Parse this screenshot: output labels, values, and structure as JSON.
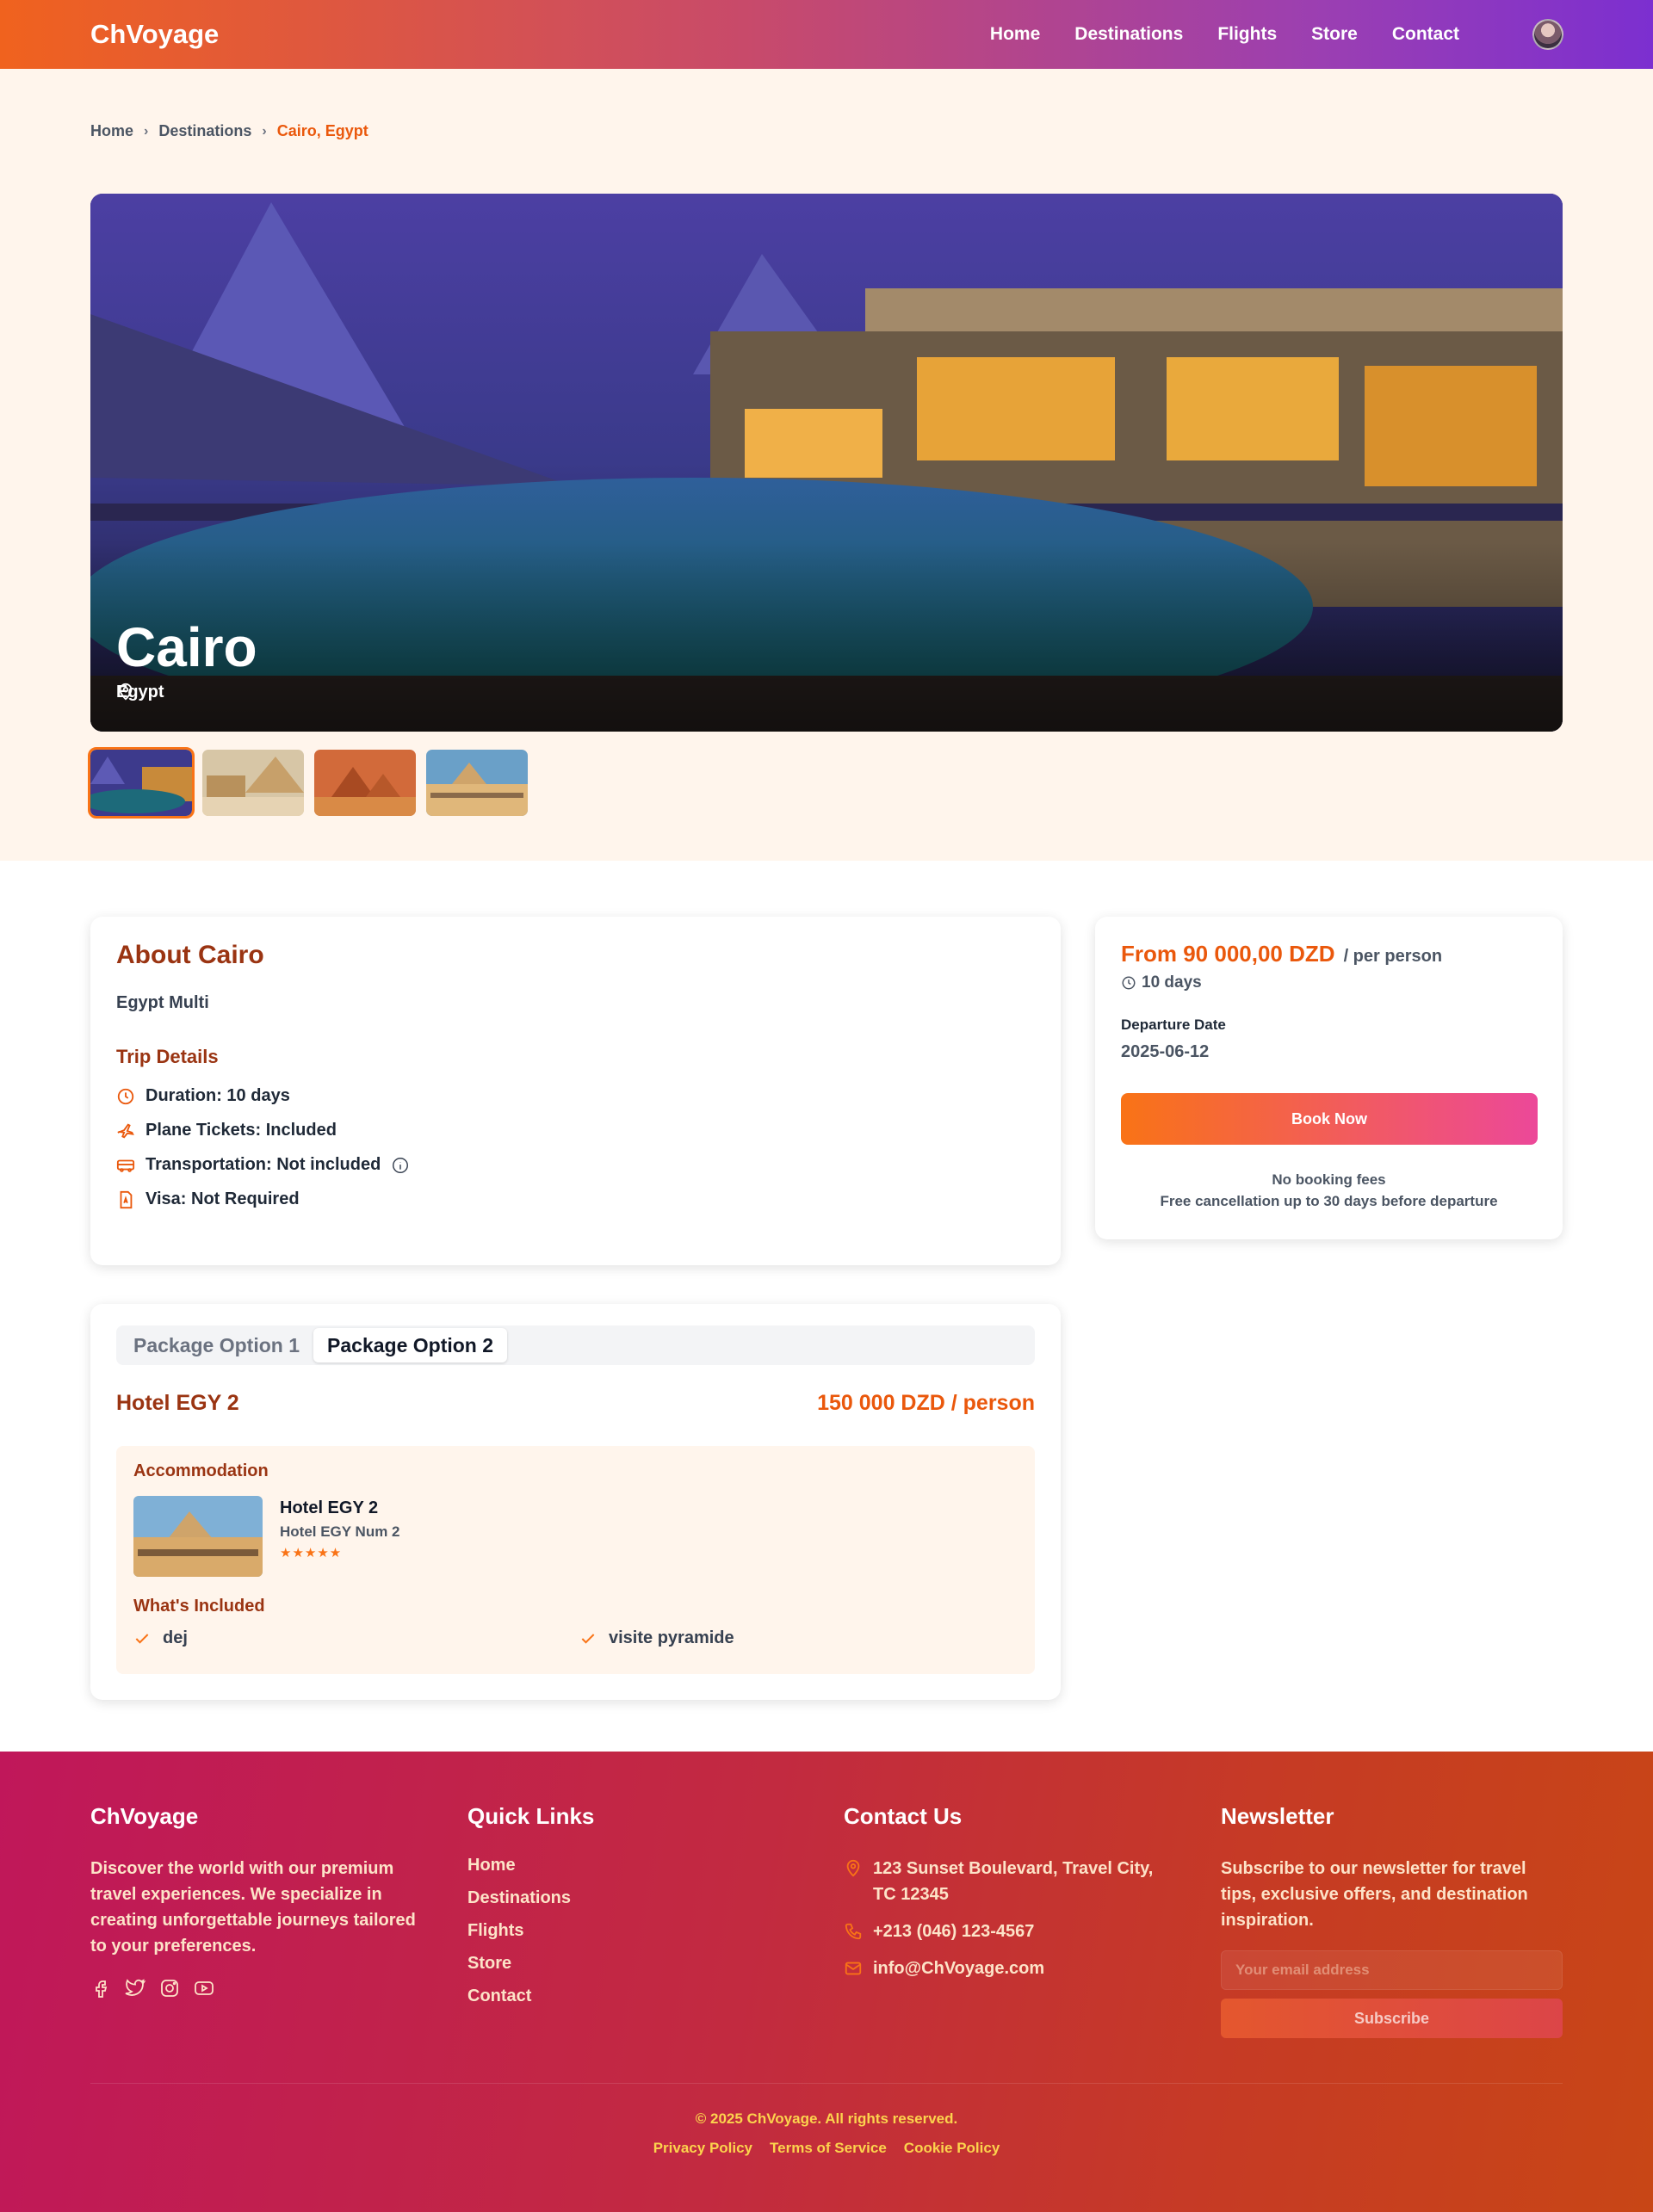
{
  "nav": {
    "brand": "ChVoyage",
    "links": [
      "Home",
      "Destinations",
      "Flights",
      "Store",
      "Contact"
    ]
  },
  "breadcrumb": {
    "items": [
      "Home",
      "Destinations"
    ],
    "current": "Cairo, Egypt"
  },
  "hero": {
    "title": "Cairo",
    "country": "Egypt"
  },
  "about": {
    "title": "About Cairo",
    "subtitle": "Egypt Multi",
    "details_title": "Trip Details",
    "details": [
      "Duration: 10 days",
      "Plane Tickets: Included",
      "Transportation: Not included",
      "Visa: Not Required"
    ]
  },
  "booking": {
    "price": "From 90 000,00 DZD",
    "per": "/ per person",
    "days": "10 days",
    "departure_label": "Departure Date",
    "departure_date": "2025-06-12",
    "button": "Book Now",
    "note1": "No booking fees",
    "note2": "Free cancellation up to 30 days before departure"
  },
  "package": {
    "tabs": [
      "Package Option 1",
      "Package Option 2"
    ],
    "active_tab": "Package Option 2",
    "hotel_name": "Hotel EGY 2",
    "price": "150 000 DZD / person",
    "accommodation_title": "Accommodation",
    "acc_hotel": "Hotel EGY 2",
    "acc_sub": "Hotel EGY Num 2",
    "stars": "★★★★★",
    "rating": 5,
    "included_title": "What's Included",
    "included": [
      "dej",
      "visite pyramide"
    ]
  },
  "footer": {
    "brand": "ChVoyage",
    "about": "Discover the world with our premium travel experiences. We specialize in creating unforgettable journeys tailored to your preferences.",
    "quick_title": "Quick Links",
    "quick_links": [
      "Home",
      "Destinations",
      "Flights",
      "Store",
      "Contact"
    ],
    "contact_title": "Contact Us",
    "address": "123 Sunset Boulevard, Travel City, TC 12345",
    "phone": "+213 (046) 123-4567",
    "email": "info@ChVoyage.com",
    "newsletter_title": "Newsletter",
    "newsletter_text": "Subscribe to our newsletter for travel tips, exclusive offers, and destination inspiration.",
    "email_placeholder": "Your email address",
    "subscribe": "Subscribe",
    "copyright": "© 2025 ChVoyage. All rights reserved.",
    "legal": [
      "Privacy Policy",
      "Terms of Service",
      "Cookie Policy"
    ]
  },
  "colors": {
    "accent": "#ea580c",
    "heading": "#9a3412",
    "cream": "#fff5ec"
  },
  "icons": [
    "location-icon",
    "clock-icon",
    "plane-icon",
    "bus-icon",
    "document-icon",
    "info-icon",
    "check-icon",
    "facebook-icon",
    "twitter-icon",
    "instagram-icon",
    "youtube-icon",
    "phone-icon",
    "mail-icon",
    "chevron-right-icon"
  ]
}
